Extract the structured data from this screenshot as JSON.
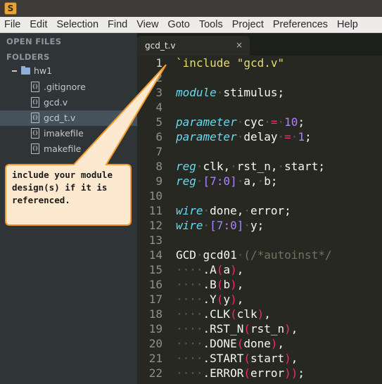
{
  "app": {
    "icon_letter": "S"
  },
  "menu": [
    "File",
    "Edit",
    "Selection",
    "Find",
    "View",
    "Goto",
    "Tools",
    "Project",
    "Preferences",
    "Help"
  ],
  "sidebar": {
    "open_files_header": "OPEN FILES",
    "folders_header": "FOLDERS",
    "folder": {
      "name": "hw1",
      "expander": "−"
    },
    "files": [
      {
        "name": ".gitignore",
        "selected": false
      },
      {
        "name": "gcd.v",
        "selected": false
      },
      {
        "name": "gcd_t.v",
        "selected": true
      },
      {
        "name": "imakefile",
        "selected": false
      },
      {
        "name": "makefile",
        "selected": false
      }
    ]
  },
  "tab": {
    "title": "gcd_t.v",
    "close": "×"
  },
  "editor": {
    "current_line": 1,
    "lines": [
      {
        "n": "1",
        "tokens": [
          [
            "str",
            "`include"
          ],
          [
            "",
            " "
          ],
          [
            "str",
            "\"gcd.v\""
          ]
        ]
      },
      {
        "n": "2",
        "tokens": []
      },
      {
        "n": "3",
        "tokens": [
          [
            "kw",
            "module"
          ],
          [
            "dot",
            "·"
          ],
          [
            "",
            "stimulus;"
          ]
        ]
      },
      {
        "n": "4",
        "tokens": []
      },
      {
        "n": "5",
        "tokens": [
          [
            "kw",
            "parameter"
          ],
          [
            "dot",
            "·"
          ],
          [
            "",
            "cyc"
          ],
          [
            "dot",
            "·"
          ],
          [
            "op",
            "="
          ],
          [
            "dot",
            "·"
          ],
          [
            "num",
            "10"
          ],
          [
            "",
            ";"
          ]
        ]
      },
      {
        "n": "6",
        "tokens": [
          [
            "kw",
            "parameter"
          ],
          [
            "dot",
            "·"
          ],
          [
            "",
            "delay"
          ],
          [
            "dot",
            "·"
          ],
          [
            "op",
            "="
          ],
          [
            "dot",
            "·"
          ],
          [
            "num",
            "1"
          ],
          [
            "",
            ";"
          ]
        ]
      },
      {
        "n": "7",
        "tokens": []
      },
      {
        "n": "8",
        "tokens": [
          [
            "kw",
            "reg"
          ],
          [
            "dot",
            "·"
          ],
          [
            "",
            "clk,"
          ],
          [
            "dot",
            "·"
          ],
          [
            "",
            "rst_n,"
          ],
          [
            "dot",
            "·"
          ],
          [
            "",
            "start;"
          ]
        ]
      },
      {
        "n": "9",
        "tokens": [
          [
            "kw",
            "reg"
          ],
          [
            "dot",
            "·"
          ],
          [
            "num",
            "[7:0]"
          ],
          [
            "dot",
            "·"
          ],
          [
            "",
            "a,"
          ],
          [
            "dot",
            "·"
          ],
          [
            "",
            "b;"
          ]
        ]
      },
      {
        "n": "10",
        "tokens": []
      },
      {
        "n": "11",
        "tokens": [
          [
            "kw",
            "wire"
          ],
          [
            "dot",
            "·"
          ],
          [
            "",
            "done,"
          ],
          [
            "dot",
            "·"
          ],
          [
            "",
            "error;"
          ]
        ]
      },
      {
        "n": "12",
        "tokens": [
          [
            "kw",
            "wire"
          ],
          [
            "dot",
            "·"
          ],
          [
            "num",
            "[7:0]"
          ],
          [
            "dot",
            "·"
          ],
          [
            "",
            "y;"
          ]
        ]
      },
      {
        "n": "13",
        "tokens": []
      },
      {
        "n": "14",
        "tokens": [
          [
            "",
            "GCD"
          ],
          [
            "dot",
            "·"
          ],
          [
            "",
            "gcd01"
          ],
          [
            "dot",
            "·"
          ],
          [
            "cmt",
            "(/*autoinst*/"
          ]
        ]
      },
      {
        "n": "15",
        "tokens": [
          [
            "dot",
            "····"
          ],
          [
            "",
            ".A"
          ],
          [
            "kwp",
            "("
          ],
          [
            "",
            "a"
          ],
          [
            "kwp",
            ")"
          ],
          [
            "",
            ","
          ]
        ]
      },
      {
        "n": "16",
        "tokens": [
          [
            "dot",
            "····"
          ],
          [
            "",
            ".B"
          ],
          [
            "kwp",
            "("
          ],
          [
            "",
            "b"
          ],
          [
            "kwp",
            ")"
          ],
          [
            "",
            ","
          ]
        ]
      },
      {
        "n": "17",
        "tokens": [
          [
            "dot",
            "····"
          ],
          [
            "",
            ".Y"
          ],
          [
            "kwp",
            "("
          ],
          [
            "",
            "y"
          ],
          [
            "kwp",
            ")"
          ],
          [
            "",
            ","
          ]
        ]
      },
      {
        "n": "18",
        "tokens": [
          [
            "dot",
            "····"
          ],
          [
            "",
            ".CLK"
          ],
          [
            "kwp",
            "("
          ],
          [
            "",
            "clk"
          ],
          [
            "kwp",
            ")"
          ],
          [
            "",
            ","
          ]
        ]
      },
      {
        "n": "19",
        "tokens": [
          [
            "dot",
            "····"
          ],
          [
            "",
            ".RST_N"
          ],
          [
            "kwp",
            "("
          ],
          [
            "",
            "rst_n"
          ],
          [
            "kwp",
            ")"
          ],
          [
            "",
            ","
          ]
        ]
      },
      {
        "n": "20",
        "tokens": [
          [
            "dot",
            "····"
          ],
          [
            "",
            ".DONE"
          ],
          [
            "kwp",
            "("
          ],
          [
            "",
            "done"
          ],
          [
            "kwp",
            ")"
          ],
          [
            "",
            ","
          ]
        ]
      },
      {
        "n": "21",
        "tokens": [
          [
            "dot",
            "····"
          ],
          [
            "",
            ".START"
          ],
          [
            "kwp",
            "("
          ],
          [
            "",
            "start"
          ],
          [
            "kwp",
            ")"
          ],
          [
            "",
            ","
          ]
        ]
      },
      {
        "n": "22",
        "tokens": [
          [
            "dot",
            "····"
          ],
          [
            "",
            ".ERROR"
          ],
          [
            "kwp",
            "("
          ],
          [
            "",
            "error"
          ],
          [
            "kwp",
            "))"
          ],
          [
            "",
            ";"
          ]
        ]
      }
    ]
  },
  "callout": {
    "lines": [
      "include your module",
      "design(s) if it is",
      "referenced."
    ],
    "fill": "#fde9cf",
    "stroke": "#f29a2e"
  }
}
